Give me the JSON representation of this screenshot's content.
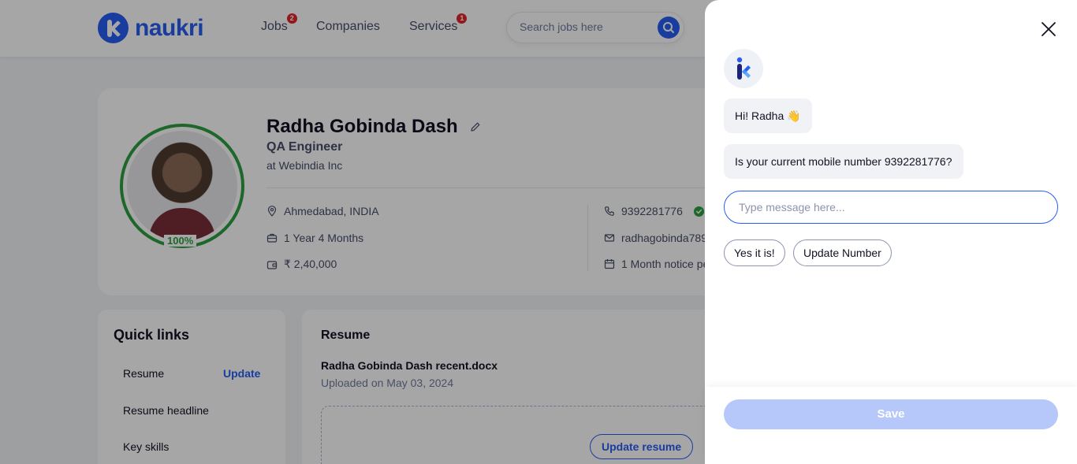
{
  "header": {
    "logo_text": "naukri",
    "nav": [
      {
        "label": "Jobs",
        "badge": "2"
      },
      {
        "label": "Companies",
        "badge": ""
      },
      {
        "label": "Services",
        "badge": "1"
      }
    ],
    "search_placeholder": "Search jobs here"
  },
  "profile": {
    "name": "Radha Gobinda Dash",
    "role": "QA Engineer",
    "company": "at Webindia Inc",
    "completion": "100%",
    "location": "Ahmedabad, INDIA",
    "experience": "1 Year 4 Months",
    "salary": "₹ 2,40,000",
    "phone": "9392281776",
    "email": "radhagobinda789",
    "notice": "1 Month notice pe"
  },
  "quick_links": {
    "title": "Quick links",
    "items": [
      "Resume",
      "Resume headline",
      "Key skills"
    ],
    "update_label": "Update"
  },
  "resume": {
    "title": "Resume",
    "file_name": "Radha Gobinda Dash recent.docx",
    "uploaded": "Uploaded on May 03, 2024",
    "update_button": "Update resume"
  },
  "chat": {
    "greeting": "Hi! Radha 👋",
    "question": "Is your current mobile number 9392281776?",
    "input_placeholder": "Type message here...",
    "options": [
      "Yes it is!",
      "Update Number"
    ],
    "save_label": "Save"
  },
  "colors": {
    "brand": "#275df5",
    "success": "#2c9e3f",
    "badge": "#e3242b",
    "save_disabled": "#b6c8fa"
  }
}
